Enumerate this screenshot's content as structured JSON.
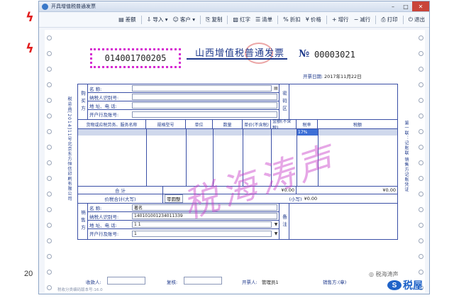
{
  "window": {
    "title": "开具增值税普通发票"
  },
  "toolbar": [
    {
      "icon": "ledger-icon",
      "glyph": "▤",
      "label": "差额"
    },
    {
      "icon": "import-icon",
      "glyph": "⇩",
      "label": "导入 ▾"
    },
    {
      "icon": "customer-icon",
      "glyph": "☺",
      "label": "客户 ▾"
    },
    {
      "icon": "copy-icon",
      "glyph": "⎘",
      "label": "复制"
    },
    {
      "icon": "red-invoice-icon",
      "glyph": "▧",
      "label": "红字"
    },
    {
      "icon": "list-icon",
      "glyph": "☰",
      "label": "清单"
    },
    {
      "icon": "discount-icon",
      "glyph": "%",
      "label": "折扣"
    },
    {
      "icon": "price-icon",
      "glyph": "¥",
      "label": "价格"
    },
    {
      "icon": "add-row-icon",
      "glyph": "+",
      "label": "增行"
    },
    {
      "icon": "remove-row-icon",
      "glyph": "−",
      "label": "减行"
    },
    {
      "icon": "print-icon",
      "glyph": "⎙",
      "label": "打印"
    },
    {
      "icon": "exit-icon",
      "glyph": "⏻",
      "label": "退出"
    }
  ],
  "invoice": {
    "code": "014001700205",
    "title": "山西增值税普通发票",
    "number_sign": "№",
    "number": "00003021",
    "date_label": "开票日期:",
    "date": "2017年11月22日",
    "left_margin_text": "税总函[2014]11号北京东方恒信印刷有限公司",
    "right_margin_text": "第一联：记账联 销售方记账凭证",
    "buyer": {
      "section": "购买方",
      "fields": [
        {
          "label": "名  称:",
          "value": ""
        },
        {
          "label": "纳税人识别号:",
          "value": ""
        },
        {
          "label": "地 址、电 话:",
          "value": ""
        },
        {
          "label": "开户行及账号:",
          "value": ""
        }
      ],
      "password_area": "密码区"
    },
    "items": {
      "headers": [
        "货物或应税劳务、服务名称",
        "规格型号",
        "单位",
        "数量",
        "单价(不含税)",
        "金额(不含税)",
        "税率",
        "税额"
      ],
      "row": {
        "tax_rate": "17%"
      }
    },
    "totals": {
      "label": "合    计",
      "amount": "¥0.00",
      "tax": "¥0.00",
      "grand_label": "价税合计(大写)",
      "grand_words": "零圆整",
      "small_label": "(小写)",
      "small_value": "¥0.00"
    },
    "seller": {
      "section": "销售方",
      "fields": [
        {
          "label": "名  称:",
          "value": "著名"
        },
        {
          "label": "纳税人识别号:",
          "value": "140101001234011339"
        },
        {
          "label": "地 址、电 话:",
          "value": "1 1"
        },
        {
          "label": "开户行及账号:",
          "value": "1"
        }
      ],
      "notes_area": "备注"
    },
    "footer": {
      "payee_label": "收款人:",
      "reviewer_label": "复核:",
      "issuer_label": "开票人:",
      "issuer": "管理员1",
      "seller_label": "销售方:(章)"
    },
    "bottom_note": "税收分类编码版本号:16.0"
  },
  "watermark": "税海涛声",
  "slide": {
    "page_prefix": "20",
    "logo_text": "税屋",
    "logo_badge": "S",
    "wechat": "◎ 税海涛声"
  }
}
